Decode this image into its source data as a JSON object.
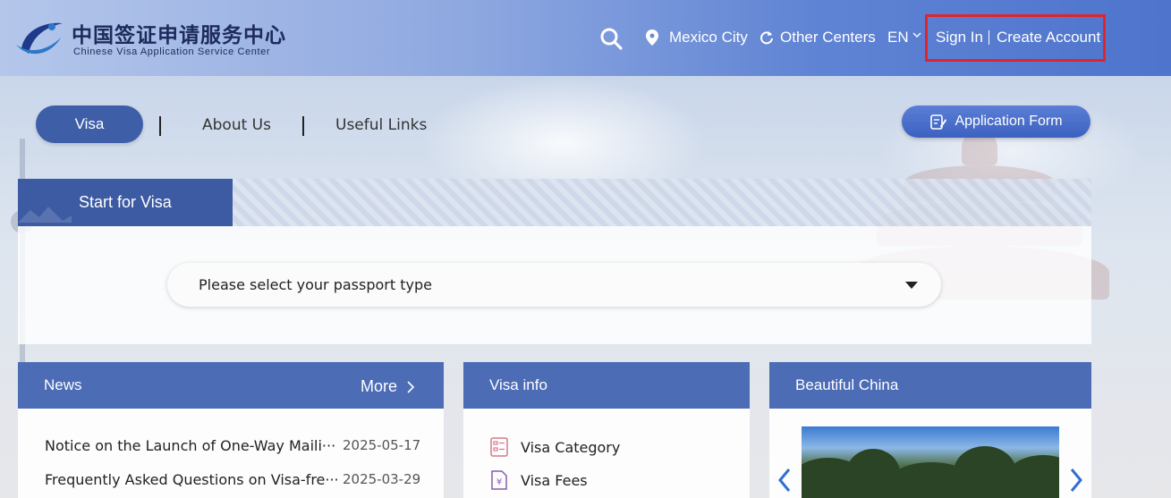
{
  "brand": {
    "name_cn": "中国签证申请服务中心",
    "name_en": "Chinese Visa Application Service Center"
  },
  "header": {
    "location": "Mexico City",
    "other_centers": "Other Centers",
    "language": "EN",
    "sign_in": "Sign In",
    "create_account": "Create Account"
  },
  "nav": {
    "visa": "Visa",
    "about": "About Us",
    "links": "Useful Links",
    "application_form": "Application Form"
  },
  "start": {
    "tab_label": "Start for Visa",
    "passport_placeholder": "Please select your passport type"
  },
  "news": {
    "title": "News",
    "more": "More",
    "items": [
      {
        "title": "Notice on the Launch of One-Way Maili···",
        "date": "2025-05-17"
      },
      {
        "title": "Frequently Asked Questions on Visa-fre···",
        "date": "2025-03-29"
      }
    ]
  },
  "visa_info": {
    "title": "Visa info",
    "items": [
      "Visa Category",
      "Visa Fees"
    ]
  },
  "beautiful_china": {
    "title": "Beautiful China"
  },
  "colors": {
    "header_accent": "#4e74cc",
    "nav_active": "#3e5ea8",
    "card_header": "#4c6cb6",
    "highlight_box": "#e0242c"
  }
}
